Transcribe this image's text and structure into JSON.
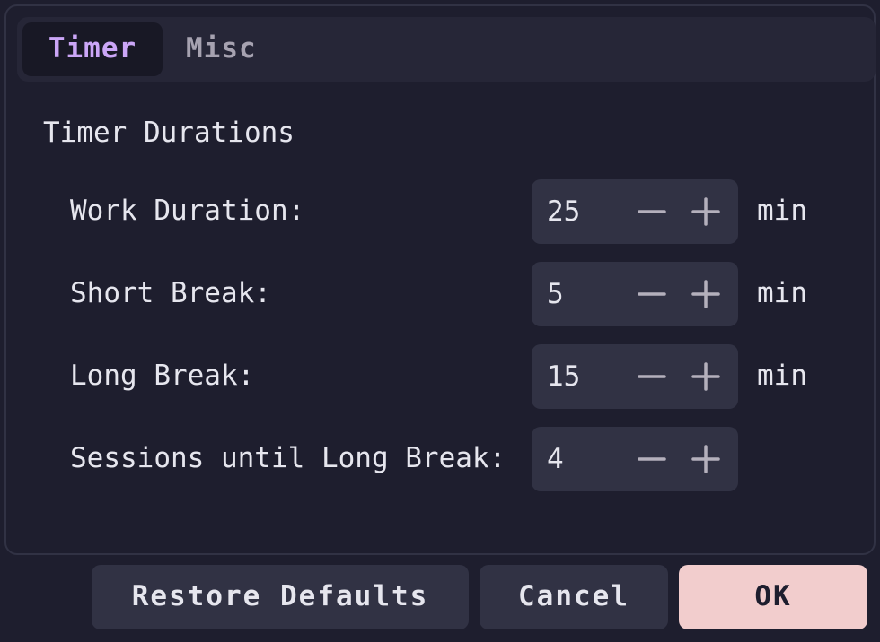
{
  "tabs": [
    {
      "label": "Timer",
      "active": true
    },
    {
      "label": "Misc",
      "active": false
    }
  ],
  "section_title": "Timer Durations",
  "rows": [
    {
      "label": "Work Duration:",
      "value": "25",
      "unit": "min"
    },
    {
      "label": "Short Break:",
      "value": "5",
      "unit": "min"
    },
    {
      "label": "Long Break:",
      "value": "15",
      "unit": "min"
    },
    {
      "label": "Sessions until Long Break:",
      "value": "4",
      "unit": ""
    }
  ],
  "buttons": {
    "restore_defaults": "Restore Defaults",
    "cancel": "Cancel",
    "ok": "OK"
  },
  "icons": {
    "decrement": "minus-icon",
    "increment": "plus-icon"
  },
  "colors": {
    "background": "#1e1e2e",
    "accent_tab": "#cba6f7",
    "ok_button": "#f2cdcd",
    "spinbox": "#313244"
  }
}
